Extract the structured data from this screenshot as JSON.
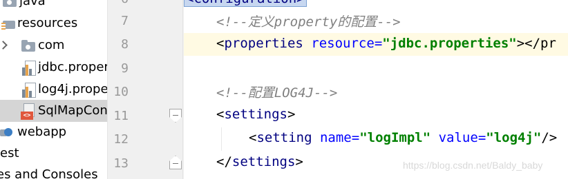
{
  "project_tree": {
    "items": [
      {
        "label": "java"
      },
      {
        "label": "resources"
      },
      {
        "label": "com"
      },
      {
        "label": "jdbc.proper"
      },
      {
        "label": "log4j.prope"
      },
      {
        "label": "SqlMapCon",
        "selected": true
      },
      {
        "label": "webapp"
      },
      {
        "label": "test"
      },
      {
        "label": "es and Consoles"
      }
    ]
  },
  "editor": {
    "top_partial": {
      "line_number": "6",
      "text": "<configuration>"
    },
    "lines": [
      {
        "number": "7",
        "text": "<!--定义property的配置-->"
      },
      {
        "number": "8",
        "tag_open": "<",
        "tag": "properties",
        "attr": "resource",
        "eq": "=",
        "value": "\"jdbc.properties\"",
        "tail": "></pr"
      },
      {
        "number": "9"
      },
      {
        "number": "10",
        "text": "<!--配置LOG4J-->"
      },
      {
        "number": "11",
        "tag_open": "<",
        "tag": "settings",
        "tag_close": ">"
      },
      {
        "number": "12",
        "tag_open": "<",
        "tag": "setting",
        "attr1": "name",
        "value1": "\"logImpl\"",
        "attr2": "value",
        "value2": "\"log4j\"",
        "tail": "/>"
      },
      {
        "number": "13",
        "tag_open": "</",
        "tag": "settings",
        "tag_close": ">"
      }
    ]
  },
  "watermark": "https://blog.csdn.net/Baldy_baby",
  "colors": {
    "tag": "#000080",
    "attribute": "#0000ff",
    "string": "#008000",
    "comment": "#808080",
    "highlight_line": "#fffae3",
    "selected_row": "#d5d5d5",
    "gutter": "#f0f0f0"
  },
  "icons": {
    "folder": "folder-icon",
    "resources_folder": "resources-folder-icon",
    "package": "package-folder-icon",
    "properties_file": "properties-file-icon",
    "xml_file": "xml-file-icon",
    "web_module": "web-folder-icon",
    "fold": "fold-marker-icon",
    "expand": "chevron-right-icon"
  }
}
